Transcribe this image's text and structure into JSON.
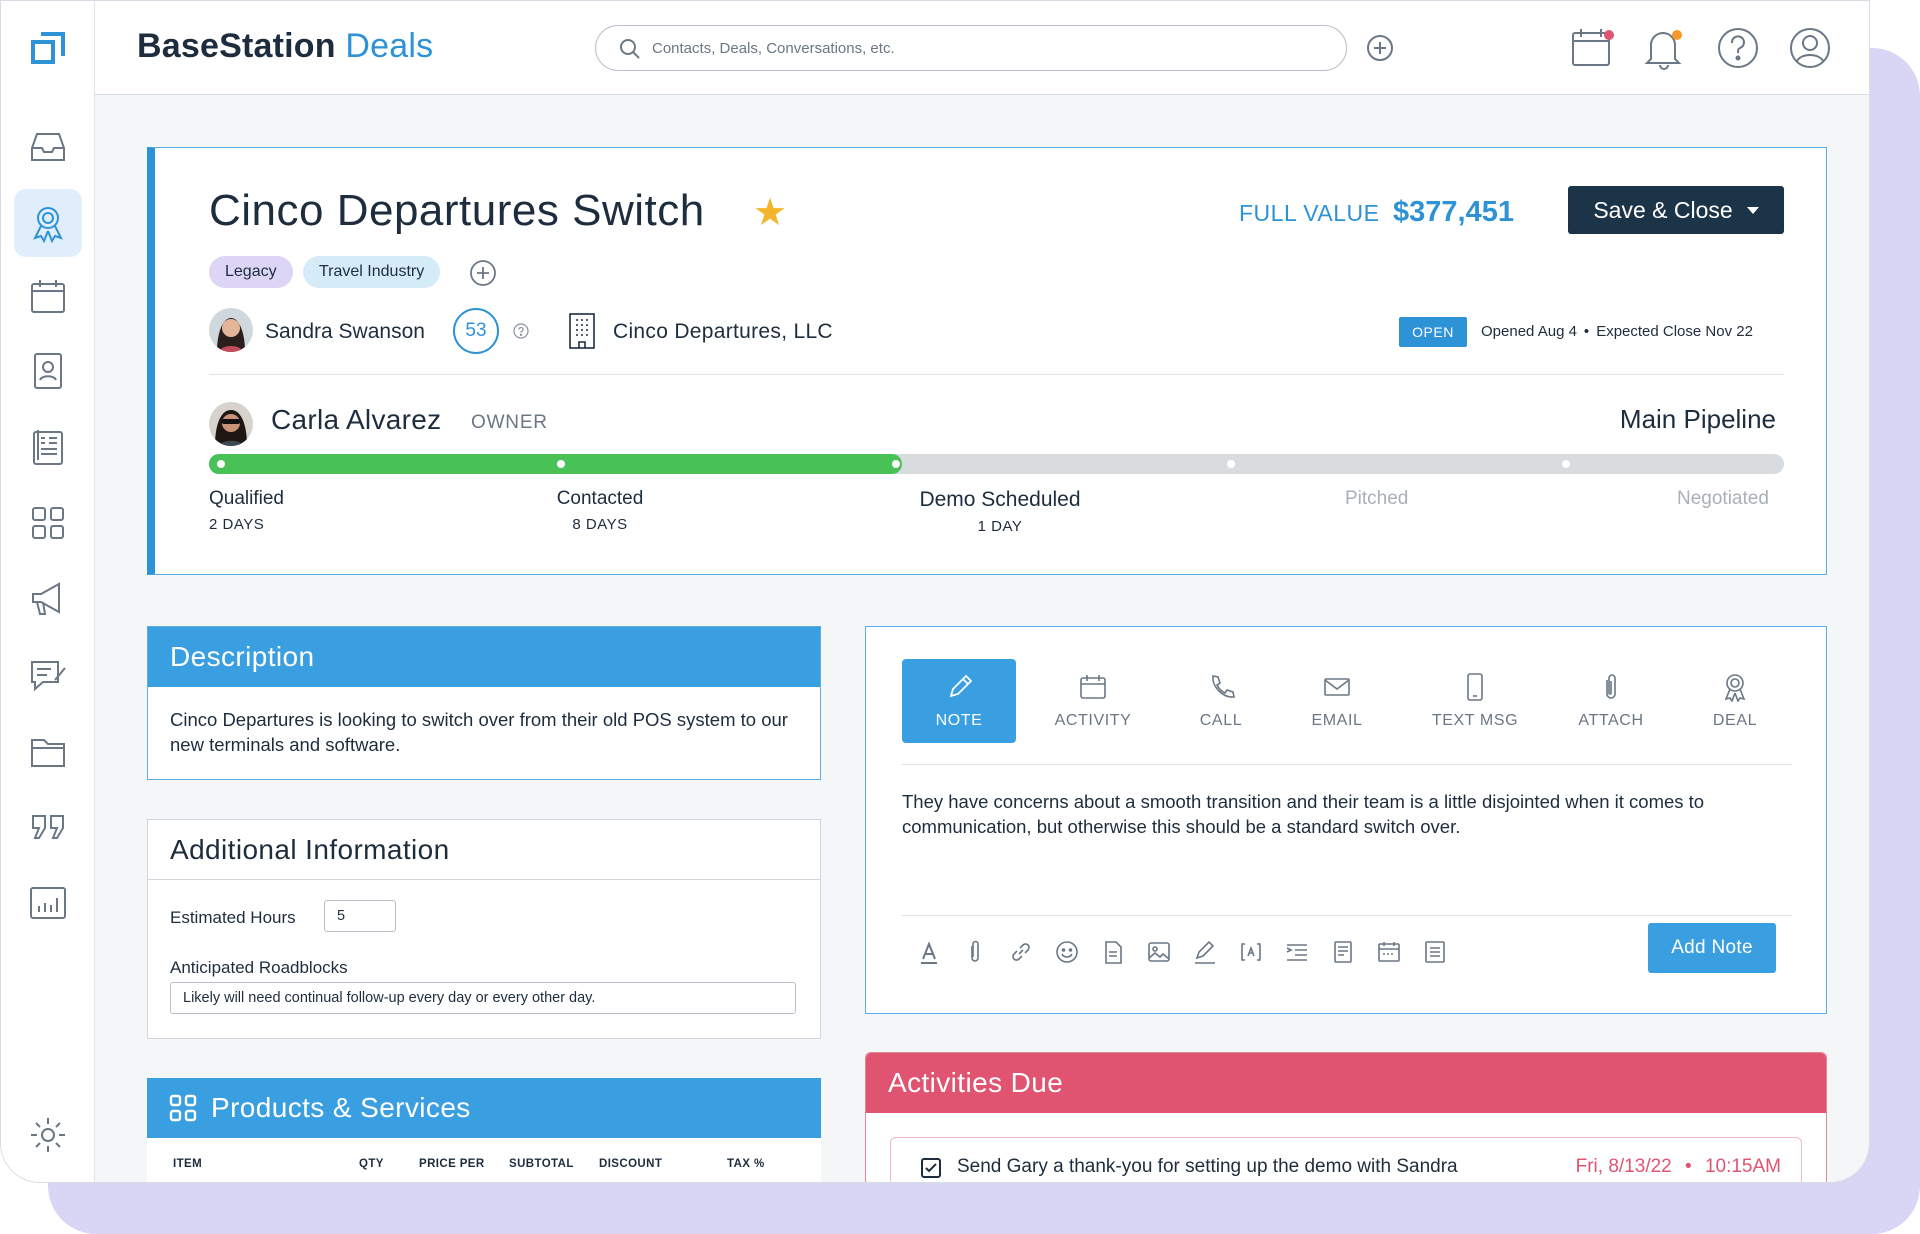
{
  "header": {
    "brand_primary": "BaseStation",
    "brand_secondary": "Deals",
    "search_placeholder": "Contacts, Deals, Conversations, etc."
  },
  "sidebar": {
    "items": [
      "inbox-icon",
      "deals-ribbon-icon",
      "calendar-icon",
      "contact-card-icon",
      "invoice-icon",
      "apps-grid-icon",
      "megaphone-icon",
      "compose-chat-icon",
      "folder-icon",
      "quote-icon",
      "reports-chart-icon",
      "settings-gear-icon"
    ],
    "active": "deals-ribbon-icon"
  },
  "deal": {
    "title": "Cinco Departures Switch",
    "full_value_label": "FULL VALUE",
    "full_value": "$377,451",
    "save_label": "Save & Close",
    "tags": [
      "Legacy",
      "Travel Industry"
    ],
    "contact_name": "Sandra Swanson",
    "contact_score": "53",
    "company": "Cinco Departures, LLC",
    "status": "OPEN",
    "opened": "Opened Aug 4",
    "expected_close": "Expected Close Nov 22",
    "owner_name": "Carla Alvarez",
    "owner_label": "OWNER",
    "pipeline": "Main Pipeline",
    "progress_fraction": 0.44,
    "stages": [
      {
        "name": "Qualified",
        "days": "2 DAYS"
      },
      {
        "name": "Contacted",
        "days": "8 DAYS"
      },
      {
        "name": "Demo Scheduled",
        "days": "1 DAY"
      },
      {
        "name": "Pitched",
        "days": ""
      },
      {
        "name": "Negotiated",
        "days": ""
      }
    ]
  },
  "description": {
    "title": "Description",
    "text": "Cinco Departures is looking to switch over from their old POS system to our new terminals and software."
  },
  "additional": {
    "title": "Additional Information",
    "hours_label": "Estimated Hours",
    "hours_value": "5",
    "roadblocks_label": "Anticipated Roadblocks",
    "roadblocks_value": "Likely will need continual follow-up every day or every other day."
  },
  "products": {
    "title": "Products & Services",
    "columns": [
      "ITEM",
      "QTY",
      "PRICE PER",
      "SUBTOTAL",
      "DISCOUNT",
      "TAX %"
    ]
  },
  "composer": {
    "tabs": [
      "NOTE",
      "ACTIVITY",
      "CALL",
      "EMAIL",
      "TEXT MSG",
      "ATTACH",
      "DEAL"
    ],
    "active_tab": "NOTE",
    "note_text": "They have concerns about a smooth transition and their team is a little disjointed when it comes to communication, but otherwise this should be a standard switch over.",
    "add_note_label": "Add Note"
  },
  "activities": {
    "title": "Activities Due",
    "items": [
      {
        "text": "Send Gary a thank-you for setting up the demo with Sandra",
        "date": "Fri, 8/13/22",
        "time": "10:15AM"
      }
    ]
  },
  "colors": {
    "accent": "#2e93d6",
    "dark_button": "#1b3448",
    "progress_done": "#48c156",
    "activities": "#e05472",
    "star": "#f3b62b"
  }
}
